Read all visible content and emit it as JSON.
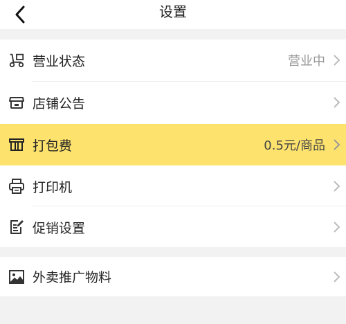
{
  "header": {
    "title": "设置",
    "back_icon": "chevron-left-icon"
  },
  "groups": [
    {
      "items": [
        {
          "label": "营业状态",
          "value": "营业中",
          "icon": "scooter-icon"
        },
        {
          "label": "店铺公告",
          "value": "",
          "icon": "storefront-icon"
        },
        {
          "label": "打包费",
          "value": "0.5元/商品",
          "icon": "package-icon",
          "highlighted": true
        },
        {
          "label": "打印机",
          "value": "",
          "icon": "printer-icon"
        },
        {
          "label": "促销设置",
          "value": "",
          "icon": "edit-doc-icon"
        }
      ]
    },
    {
      "items": [
        {
          "label": "外卖推广物料",
          "value": "",
          "icon": "image-icon"
        }
      ]
    }
  ],
  "colors": {
    "highlight": "#fde36e",
    "background": "#f2f2f2"
  }
}
